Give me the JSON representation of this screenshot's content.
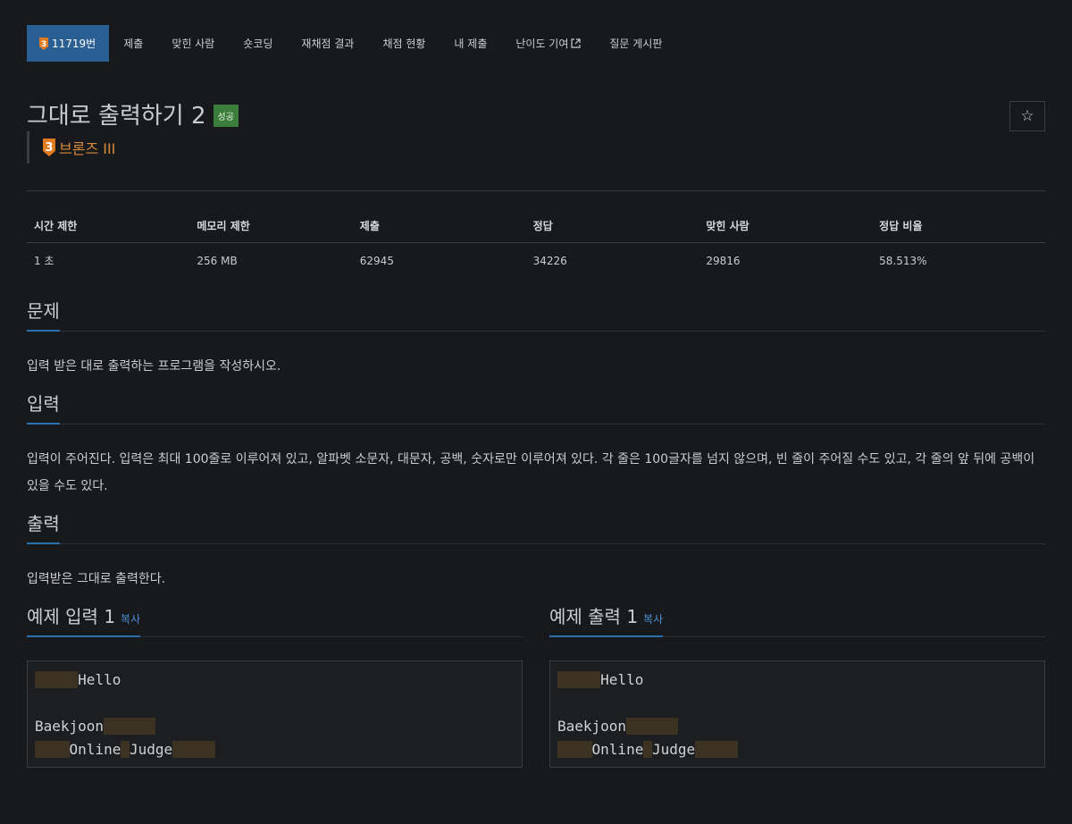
{
  "nav": {
    "problem_id": "11719번",
    "tabs": [
      "제출",
      "맞힌 사람",
      "숏코딩",
      "재채점 결과",
      "채점 현황",
      "내 제출",
      "난이도 기여",
      "질문 게시판"
    ]
  },
  "problem": {
    "title": "그대로 출력하기 2",
    "status_badge": "성공",
    "tier_level": "3",
    "tier_name": "브론즈 III"
  },
  "info_table": {
    "headers": [
      "시간 제한",
      "메모리 제한",
      "제출",
      "정답",
      "맞힌 사람",
      "정답 비율"
    ],
    "values": [
      "1 초",
      "256 MB",
      "62945",
      "34226",
      "29816",
      "58.513%"
    ]
  },
  "sections": {
    "problem": {
      "title": "문제",
      "text": "입력 받은 대로 출력하는 프로그램을 작성하시오."
    },
    "input": {
      "title": "입력",
      "text": "입력이 주어진다. 입력은 최대 100줄로 이루어져 있고, 알파벳 소문자, 대문자, 공백, 숫자로만 이루어져 있다. 각 줄은 100글자를 넘지 않으며, 빈 줄이 주어질 수도 있고, 각 줄의 앞 뒤에 공백이 있을 수도 있다."
    },
    "output": {
      "title": "출력",
      "text": "입력받은 그대로 출력한다."
    }
  },
  "samples": {
    "input_title": "예제 입력 1",
    "output_title": "예제 출력 1",
    "copy_label": "복사",
    "words": [
      "Hello",
      "Baekjoon",
      "Online",
      "Judge"
    ]
  },
  "icons": {
    "star": "star-icon",
    "external": "external-link-icon"
  },
  "colors": {
    "bg": "#17191c",
    "active_tab": "#2a5f93",
    "success": "#3b7d3b",
    "bronze": "#d98a3a",
    "link": "#4f8fd6"
  }
}
